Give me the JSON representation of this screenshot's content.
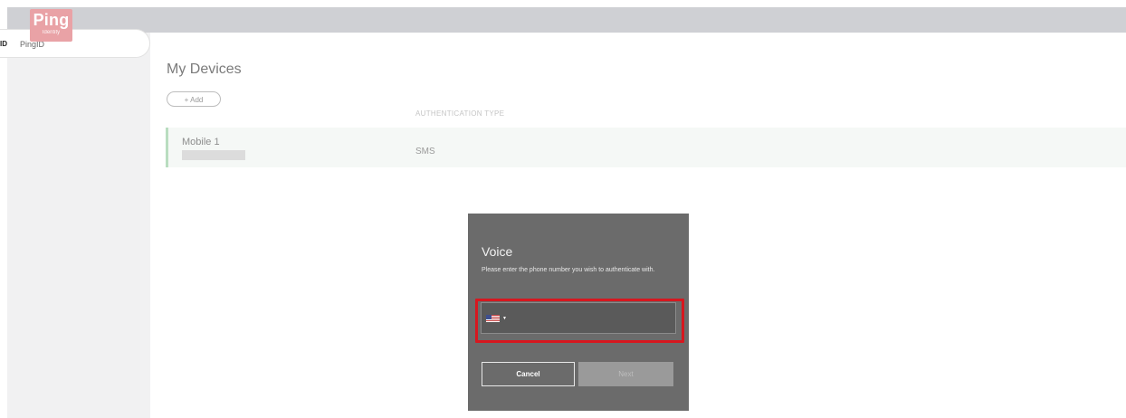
{
  "app": {
    "logo_text": "Ping",
    "logo_subtext": "Identity"
  },
  "sidebar": {
    "items": [
      {
        "icon_text": "ID",
        "label": "PingID",
        "selected": true
      }
    ]
  },
  "main": {
    "title": "My Devices",
    "add_button_label": "+ Add",
    "column_header": "AUTHENTICATION TYPE",
    "devices": [
      {
        "name": "Mobile 1",
        "type": "SMS"
      }
    ]
  },
  "modal": {
    "title": "Voice",
    "description": "Please enter the phone number you wish to authenticate with.",
    "phone_value": "",
    "country_flag": "us-flag-icon",
    "cancel_label": "Cancel",
    "next_label": "Next"
  },
  "colors": {
    "highlight": "#d7171f",
    "logo_bg": "#e9a2a6",
    "modal_bg": "#6b6b6b",
    "device_accent": "#b9ddc0"
  }
}
